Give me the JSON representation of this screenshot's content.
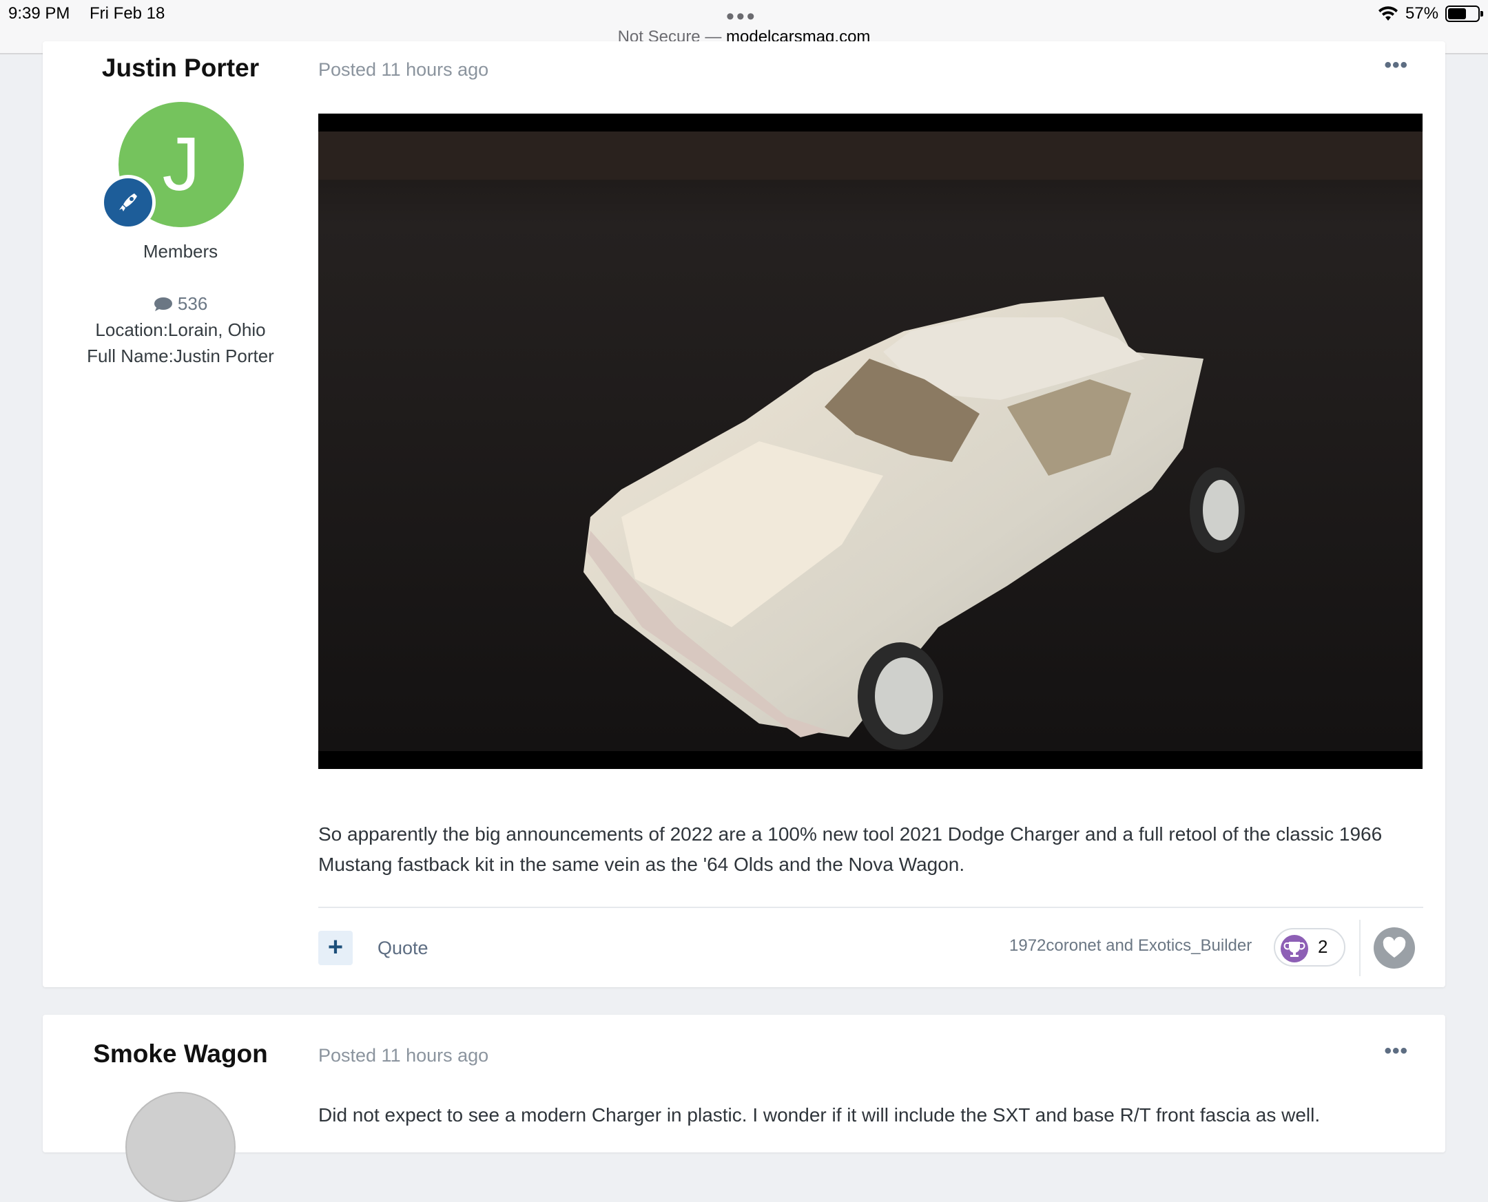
{
  "status_bar": {
    "time": "9:39 PM",
    "date": "Fri Feb 18",
    "battery": "57%",
    "url_prefix": "Not Secure — ",
    "url_host": "modelcarsmag.com"
  },
  "posts": [
    {
      "author": "Justin Porter",
      "avatar_letter": "J",
      "avatar_color": "#75c35d",
      "group": "Members",
      "post_count": "536",
      "location": "Location:Lorain, Ohio",
      "full_name": "Full Name:Justin Porter",
      "posted": "Posted 11 hours ago",
      "body": "So apparently the big announcements of 2022 are a 100% new tool 2021 Dodge Charger and a full retool of the classic 1966 Mustang fastback kit in the same vein as the '64 Olds and the Nova Wagon.",
      "quote_label": "Quote",
      "reacted_by": "1972coronet and Exotics_Builder",
      "reaction_count": "2",
      "reaction_icon": "trophy-icon"
    },
    {
      "author": "Smoke Wagon",
      "posted": "Posted 11 hours ago",
      "body": "Did not expect to see a modern Charger in plastic. I wonder if it will include the SXT and base R/T front fascia as well."
    }
  ]
}
